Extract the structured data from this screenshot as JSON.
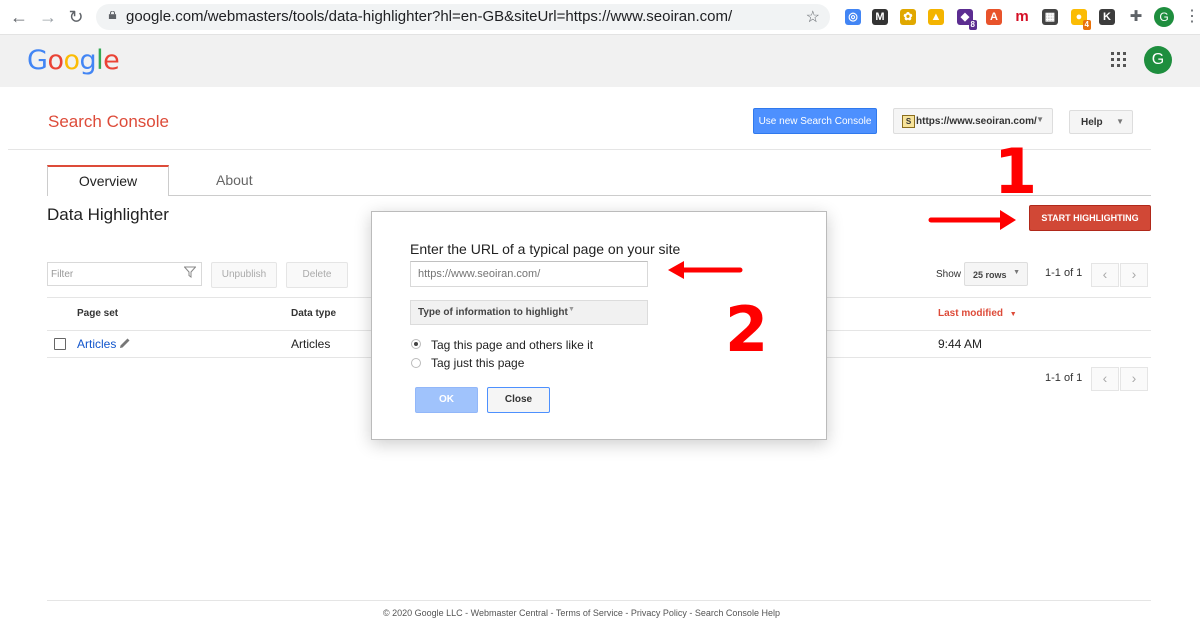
{
  "browser": {
    "url": "google.com/webmasters/tools/data-highlighter?hl=en-GB&siteUrl=https://www.seoiran.com/",
    "back_icon": "back-arrow-icon",
    "forward_icon": "forward-arrow-icon",
    "reload_icon": "reload-icon",
    "extensions": [
      {
        "name": "ext-1",
        "bg": "#4285f4",
        "glyph": "◎"
      },
      {
        "name": "ext-2",
        "bg": "#333333",
        "glyph": "M"
      },
      {
        "name": "ext-3",
        "bg": "#e0a800",
        "glyph": "✿"
      },
      {
        "name": "ext-4",
        "bg": "#f4b400",
        "glyph": "▲"
      },
      {
        "name": "ext-5",
        "bg": "#5c2d91",
        "glyph": "◆",
        "badge": "8"
      },
      {
        "name": "ext-6",
        "bg": "#e8532b",
        "glyph": "A"
      },
      {
        "name": "ext-7",
        "bg": "#ffffff",
        "glyph": "m"
      },
      {
        "name": "ext-8",
        "bg": "#444444",
        "glyph": "▦"
      },
      {
        "name": "ext-9",
        "bg": "#fbbc04",
        "glyph": "●",
        "badge": "4"
      },
      {
        "name": "ext-10",
        "bg": "#3c3c3c",
        "glyph": "K"
      }
    ],
    "profile_initial": "G"
  },
  "google_header": {
    "logo_letters": [
      {
        "ch": "G",
        "color": "#4285f4"
      },
      {
        "ch": "o",
        "color": "#ea4335"
      },
      {
        "ch": "o",
        "color": "#fbbc05"
      },
      {
        "ch": "g",
        "color": "#4285f4"
      },
      {
        "ch": "l",
        "color": "#34a853"
      },
      {
        "ch": "e",
        "color": "#ea4335"
      }
    ],
    "avatar_initial": "G"
  },
  "sc_header": {
    "title": "Search Console",
    "new_console_button": "Use new Search Console",
    "site_favicon": "S",
    "site_selector": "https://www.seoiran.com/",
    "help_button": "Help"
  },
  "tabs": [
    {
      "label": "Overview",
      "active": true
    },
    {
      "label": "About",
      "active": false
    }
  ],
  "page": {
    "heading": "Data Highlighter",
    "start_button": "START HIGHLIGHTING"
  },
  "toolbar": {
    "filter_placeholder": "Filter",
    "unpublish_button": "Unpublish",
    "delete_button": "Delete",
    "show_label": "Show",
    "rows_select": "25 rows",
    "pager_text": "1-1 of 1"
  },
  "table": {
    "columns": [
      "Page set",
      "Data type",
      "Last modified"
    ],
    "rows": [
      {
        "page_set": "Articles",
        "data_type": "Articles",
        "last_modified": "9:44 AM"
      }
    ]
  },
  "footer": {
    "text": "© 2020 Google LLC - Webmaster Central - Terms of Service - Privacy Policy - Search Console Help"
  },
  "dialog": {
    "title": "Enter the URL of a typical page on your site",
    "url_placeholder": "https://www.seoiran.com/",
    "type_select": "Type of information to highlight",
    "radio_options": [
      {
        "label": "Tag this page and others like it",
        "selected": true
      },
      {
        "label": "Tag just this page",
        "selected": false
      }
    ],
    "ok_button": "OK",
    "close_button": "Close"
  },
  "annotations": {
    "step1": "1",
    "step2": "2",
    "color": "#ff0000"
  },
  "colors": {
    "accent_red": "#dd4b39",
    "start_button": "#d14836",
    "blue_button": "#4d90fe",
    "link": "#1155cc"
  }
}
